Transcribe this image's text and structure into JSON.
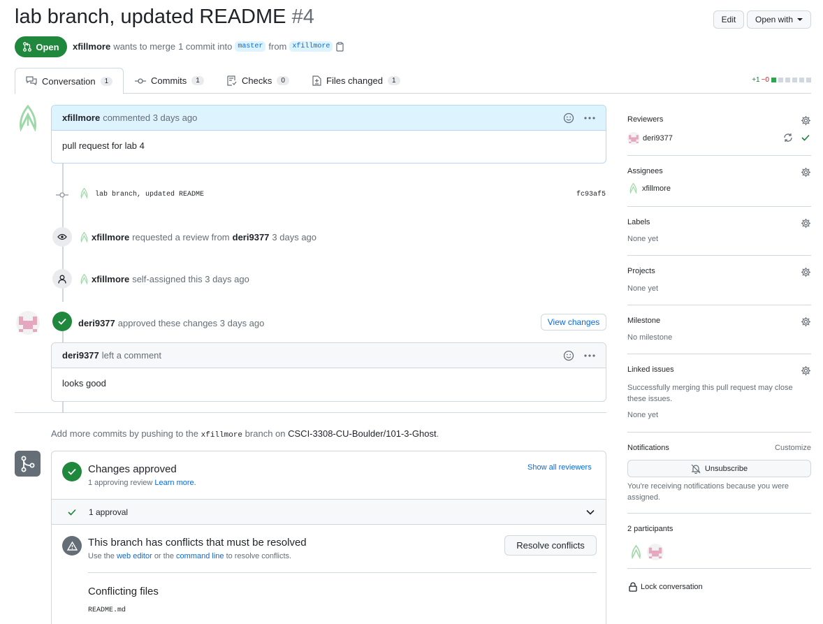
{
  "pr": {
    "title": "lab branch, updated README",
    "number": "#4",
    "state": "Open",
    "author": "xfillmore",
    "merge_text_a": "wants to merge",
    "merge_count": "1 commit into",
    "base_branch": "master",
    "from_text": "from",
    "head_branch": "xfillmore"
  },
  "header_buttons": {
    "edit": "Edit",
    "open_with": "Open with"
  },
  "tabs": [
    {
      "label": "Conversation",
      "count": "1"
    },
    {
      "label": "Commits",
      "count": "1"
    },
    {
      "label": "Checks",
      "count": "0"
    },
    {
      "label": "Files changed",
      "count": "1"
    }
  ],
  "diffstat": {
    "add": "+1",
    "del": "−0"
  },
  "timeline": {
    "comment1": {
      "author": "xfillmore",
      "meta": "commented 3 days ago",
      "body": "pull request for lab 4"
    },
    "commit": {
      "message": "lab branch, updated README",
      "sha": "fc93af5"
    },
    "review_request": {
      "actor": "xfillmore",
      "text": "requested a review from",
      "target": "deri9377",
      "time": "3 days ago"
    },
    "self_assign": {
      "actor": "xfillmore",
      "text": "self-assigned this 3 days ago"
    },
    "approval": {
      "actor": "deri9377",
      "text": "approved these changes 3 days ago",
      "button": "View changes"
    },
    "comment2": {
      "author": "deri9377",
      "meta": "left a comment",
      "body": "looks good"
    }
  },
  "push_hint": {
    "a": "Add more commits by pushing to the",
    "branch": "xfillmore",
    "b": "branch on",
    "repo": "CSCI-3308-CU-Boulder/101-3-Ghost",
    "c": "."
  },
  "merge": {
    "approved_title": "Changes approved",
    "approved_sub": "1 approving review",
    "learn_more": "Learn more.",
    "show_reviewers": "Show all reviewers",
    "approval_count": "1 approval",
    "conflict_title": "This branch has conflicts that must be resolved",
    "conflict_a": "Use the",
    "web_editor": "web editor",
    "conflict_b": "or the",
    "command_line": "command line",
    "conflict_c": "to resolve conflicts.",
    "resolve_button": "Resolve conflicts",
    "conflicting_files_title": "Conflicting files",
    "conflict_file": "README.md"
  },
  "sidebar": {
    "reviewers": {
      "title": "Reviewers",
      "user": "deri9377"
    },
    "assignees": {
      "title": "Assignees",
      "user": "xfillmore"
    },
    "labels": {
      "title": "Labels",
      "value": "None yet"
    },
    "projects": {
      "title": "Projects",
      "value": "None yet"
    },
    "milestone": {
      "title": "Milestone",
      "value": "No milestone"
    },
    "linked": {
      "title": "Linked issues",
      "desc": "Successfully merging this pull request may close these issues.",
      "value": "None yet"
    },
    "notifications": {
      "title": "Notifications",
      "customize": "Customize",
      "button": "Unsubscribe",
      "desc": "You're receiving notifications because you were assigned."
    },
    "participants": {
      "title": "2 participants"
    },
    "lock": "Lock conversation"
  },
  "colors": {
    "green": "#1f883d",
    "link": "#0969da",
    "border": "#d0d7de"
  }
}
